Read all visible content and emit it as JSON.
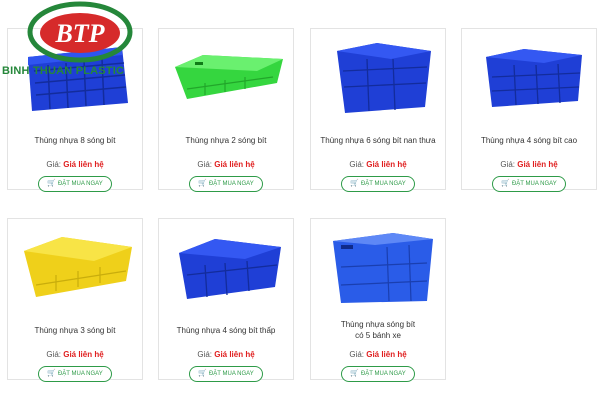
{
  "logo": {
    "mark": "BTP",
    "name": "BINH THUAN PLASTIC"
  },
  "price_label": "Giá:",
  "buy_icon": "cart-icon",
  "products": [
    {
      "name": "Thùng nhựa 8 sóng bít",
      "price": "Giá liên hệ",
      "button": "ĐẶT MUA NGAY",
      "color": "#1f3fd6"
    },
    {
      "name": "Thùng nhựa 2 sóng bít",
      "price": "Giá liên hệ",
      "button": "ĐẶT MUA NGAY",
      "color": "#3ee34a"
    },
    {
      "name": "Thùng nhựa 6 sóng bít nan thưa",
      "price": "Giá liên hệ",
      "button": "ĐẶT MUA NGAY",
      "color": "#1f3fd6"
    },
    {
      "name": "Thùng nhựa 4 sóng bít cao",
      "price": "Giá liên hệ",
      "button": "ĐẶT MUA NGAY",
      "color": "#1f3fd6"
    },
    {
      "name": "Thùng nhựa 3 sóng bít",
      "price": "Giá liên hệ",
      "button": "ĐẶT MUA NGAY",
      "color": "#f2d41c"
    },
    {
      "name": "Thùng nhựa 4 sóng bít thấp",
      "price": "Giá liên hệ",
      "button": "ĐẶT MUA NGAY",
      "color": "#1f3fd6"
    },
    {
      "name_line1": "Thùng nhựa sóng bít",
      "name_line2": "có 5 bánh xe",
      "price": "Giá liên hệ",
      "button": "ĐẶT MUA NGAY",
      "color": "#2a5ce8"
    }
  ]
}
